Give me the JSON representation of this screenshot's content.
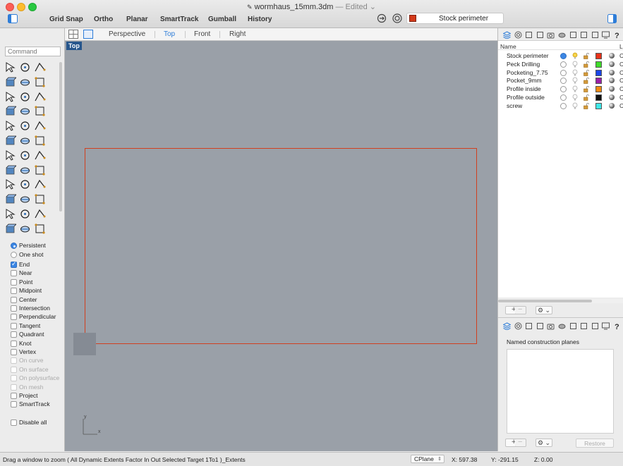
{
  "window": {
    "title": "wormhaus_15mm.3dm",
    "status": "— Edited ⌄",
    "traffic_colors": [
      "#fc5f57",
      "#fdbc2e",
      "#28c840"
    ]
  },
  "toolbar": {
    "grid_snap": "Grid Snap",
    "ortho": "Ortho",
    "planar": "Planar",
    "smarttrack": "SmartTrack",
    "gumball": "Gumball",
    "history": "History",
    "current_layer": "Stock perimeter",
    "current_layer_color": "#d33a1a"
  },
  "command": {
    "placeholder": "Command"
  },
  "osnap": {
    "modes": [
      {
        "label": "Persistent",
        "selected": true
      },
      {
        "label": "One shot",
        "selected": false
      }
    ],
    "items": [
      {
        "label": "End",
        "checked": true,
        "enabled": true
      },
      {
        "label": "Near",
        "checked": false,
        "enabled": true
      },
      {
        "label": "Point",
        "checked": false,
        "enabled": true
      },
      {
        "label": "Midpoint",
        "checked": false,
        "enabled": true
      },
      {
        "label": "Center",
        "checked": false,
        "enabled": true
      },
      {
        "label": "Intersection",
        "checked": false,
        "enabled": true
      },
      {
        "label": "Perpendicular",
        "checked": false,
        "enabled": true
      },
      {
        "label": "Tangent",
        "checked": false,
        "enabled": true
      },
      {
        "label": "Quadrant",
        "checked": false,
        "enabled": true
      },
      {
        "label": "Knot",
        "checked": false,
        "enabled": true
      },
      {
        "label": "Vertex",
        "checked": false,
        "enabled": true
      },
      {
        "label": "On curve",
        "checked": false,
        "enabled": false
      },
      {
        "label": "On surface",
        "checked": false,
        "enabled": false
      },
      {
        "label": "On polysurface",
        "checked": false,
        "enabled": false
      },
      {
        "label": "On mesh",
        "checked": false,
        "enabled": false
      },
      {
        "label": "Project",
        "checked": false,
        "enabled": true
      },
      {
        "label": "SmartTrack",
        "checked": false,
        "enabled": true
      }
    ],
    "disable_all": "Disable all"
  },
  "viewport": {
    "tabs": [
      "Perspective",
      "Top",
      "Front",
      "Right"
    ],
    "active_tab": "Top",
    "label": "Top",
    "axis_x": "x",
    "axis_y": "y"
  },
  "layers": {
    "header_name": "Name",
    "header_col2": "Li",
    "rows": [
      {
        "name": "Stock perimeter",
        "current": true,
        "color": "#e8321a",
        "cut": "C"
      },
      {
        "name": "Peck Drilling",
        "current": false,
        "color": "#3fdc2a",
        "cut": "C"
      },
      {
        "name": "Pocketing_7.75",
        "current": false,
        "color": "#1a46e8",
        "cut": "C"
      },
      {
        "name": "Pocket_9mm",
        "current": false,
        "color": "#9a1fa8",
        "cut": "C"
      },
      {
        "name": "Profile inside",
        "current": false,
        "color": "#f08a10",
        "cut": "C"
      },
      {
        "name": "Profile outside",
        "current": false,
        "color": "#111111",
        "cut": "C"
      },
      {
        "name": "screw",
        "current": false,
        "color": "#3fe8e8",
        "cut": "C"
      }
    ]
  },
  "cplanes": {
    "label": "Named construction planes",
    "restore": "Restore"
  },
  "status": {
    "message": "Drag a window to zoom ( All Dynamic Extents Factor In Out Selected Target 1To1 )_Extents",
    "cplane": "CPlane",
    "x": "X: 597.38",
    "y": "Y: -291.15",
    "z": "Z: 0.00"
  }
}
